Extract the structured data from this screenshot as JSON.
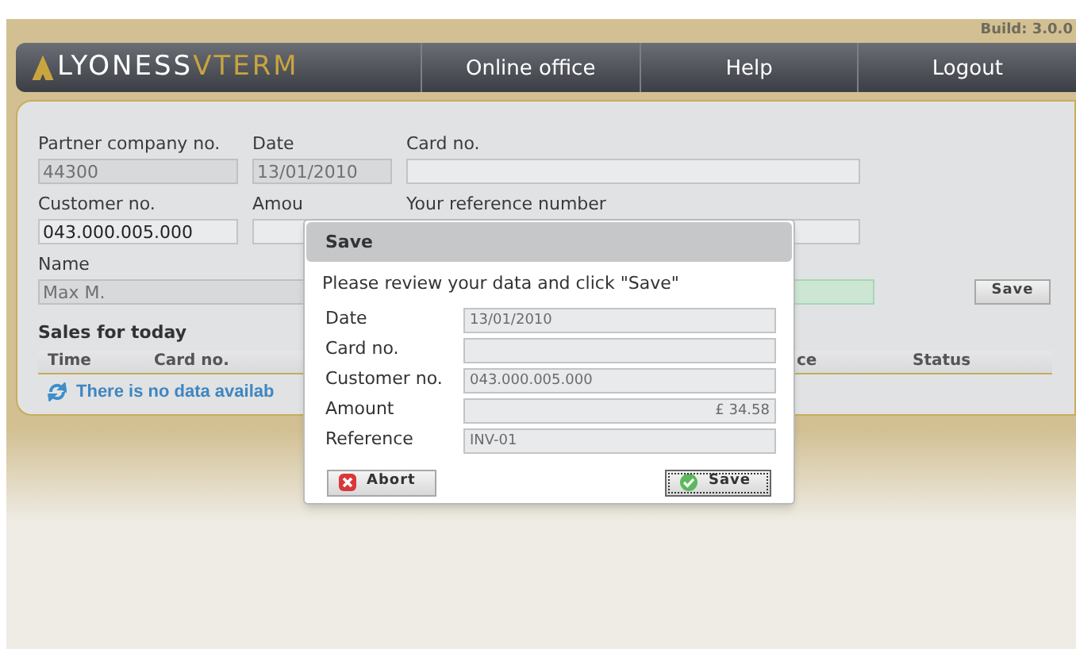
{
  "build": "Build: 3.0.0",
  "logo": {
    "part_1": "LYONESS",
    "part_2": "VTERM"
  },
  "nav": [
    {
      "label": "Online office"
    },
    {
      "label": "Help"
    },
    {
      "label": "Logout"
    }
  ],
  "form_rows": [
    [
      {
        "label": "Partner company no.",
        "value": "44300",
        "disabled": true
      },
      {
        "label": "Date",
        "value": "13/01/2010",
        "disabled": true
      },
      {
        "label": "Card no.",
        "disabled": false
      }
    ],
    [
      {
        "label": "Customer no.",
        "value": "043.000.005.000",
        "disabled": false
      },
      {
        "label": "Amou",
        "disabled": false
      },
      {
        "label": "Your reference number",
        "disabled": false
      }
    ],
    [
      {
        "label": "Name",
        "value": "Max M.",
        "disabled": true
      },
      {
        "disabled": false,
        "valid": true
      }
    ]
  ],
  "save_button": "Save",
  "sales": {
    "title": "Sales for today",
    "columns": [
      "Time",
      "Card no.",
      "ce",
      "Status"
    ],
    "empty_message": "There is no data availab"
  },
  "dialog": {
    "title": "Save",
    "message": "Please review your data and click \"Save\"",
    "rows": [
      {
        "label": "Date",
        "value": "13/01/2010",
        "kind": "text"
      },
      {
        "label": "Card no.",
        "kind": "text"
      },
      {
        "label": "Customer no.",
        "value": "043.000.005.000",
        "kind": "text"
      },
      {
        "label": "Amount",
        "value": "£ 34.58",
        "kind": "currency"
      },
      {
        "label": "Reference",
        "value": "INV-01",
        "kind": "text"
      }
    ],
    "buttons": [
      {
        "label": "Abort",
        "kind": "abort",
        "focused": false
      },
      {
        "label": "Save",
        "kind": "confirm",
        "focused": true
      }
    ]
  }
}
